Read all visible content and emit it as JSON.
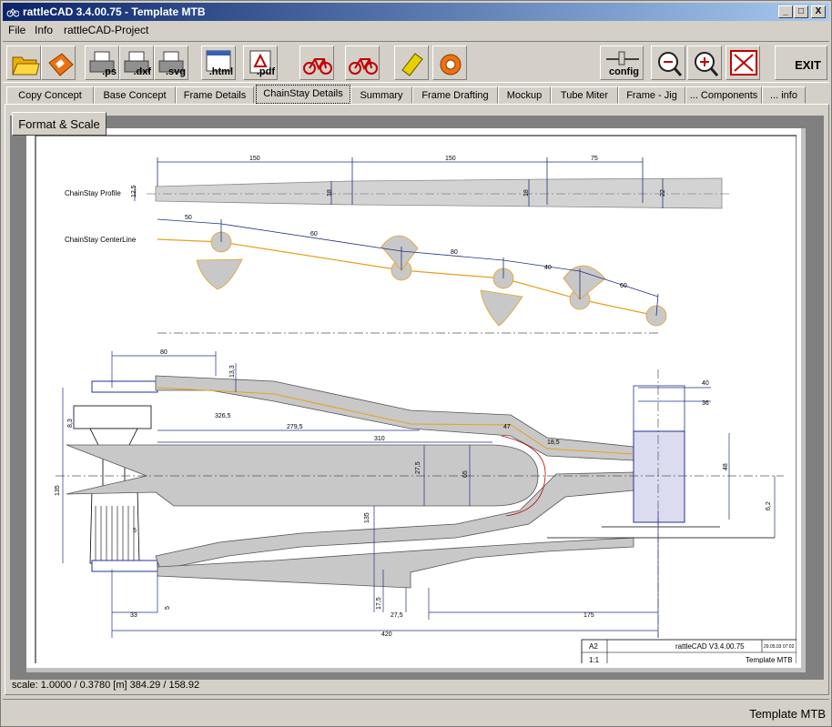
{
  "window": {
    "title": "rattleCAD  3.4.00.75 - Template MTB",
    "minimize": "_",
    "maximize": "□",
    "close": "X"
  },
  "menu": [
    "File",
    "Info",
    "rattleCAD-Project"
  ],
  "toolbar": {
    "ps": ".ps",
    "dxf": ".dxf",
    "svg": ".svg",
    "html": ".html",
    "pdf": ".pdf",
    "config": "config",
    "exit": "EXIT"
  },
  "tabs": [
    "Copy Concept",
    "Base Concept",
    "Frame Details",
    "ChainStay Details",
    "Summary",
    "Frame Drafting",
    "Mockup",
    "Tube Miter",
    "Frame - Jig",
    "... Components",
    "... info"
  ],
  "active_tab": "ChainStay Details",
  "format_button": "Format & Scale",
  "drawing": {
    "profile_label": "ChainStay Profile",
    "centerline_label": "ChainStay CenterLine",
    "profile_dims": [
      "150",
      "150",
      "75",
      "12,5",
      "18",
      "18",
      "22"
    ],
    "centerline_dims": [
      "50",
      "60",
      "80",
      "40",
      "60"
    ],
    "main_dims": [
      "80",
      "13,3",
      "326,5",
      "279,5",
      "310",
      "27,5",
      "47",
      "18,5",
      "40",
      "36",
      "65",
      "48",
      "135",
      "8,3",
      "5",
      "33",
      "33",
      "5",
      "6,2",
      "135",
      "17,5",
      "27,5",
      "175",
      "420"
    ],
    "titleblock": {
      "format": "A2",
      "scale": "1:1",
      "app": "rattleCAD   V3.4.00.75",
      "date": "29.05.03 07:02",
      "name": "Template MTB"
    }
  },
  "status": {
    "scale": "scale: 1.0000 / 0.3780  [m]  384.29 / 158.92",
    "project": "Template MTB"
  }
}
